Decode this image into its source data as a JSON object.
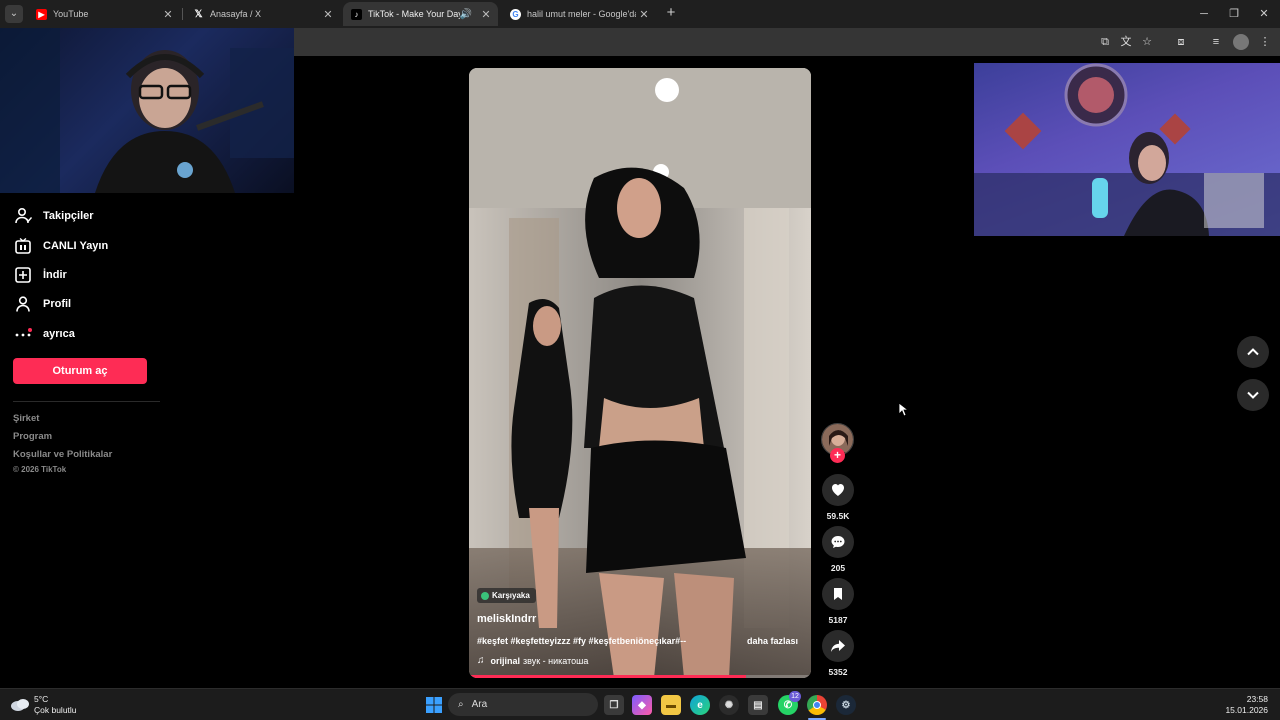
{
  "browser": {
    "tabs": [
      {
        "title": "YouTube",
        "active": false,
        "icon": "youtube-icon"
      },
      {
        "title": "Anasayfa / X",
        "active": false,
        "icon": "x-icon"
      },
      {
        "title": "TikTok - Make Your Day",
        "active": true,
        "icon": "tiktok-icon",
        "audio": true
      },
      {
        "title": "halil umut meler - Google'da Ara",
        "active": false,
        "icon": "google-icon"
      }
    ],
    "new_tab_icon": "plus-icon",
    "window_controls": [
      "minimize-icon",
      "restore-icon",
      "close-icon"
    ]
  },
  "sidebar": {
    "items": [
      {
        "label": "Takipçiler",
        "icon": "person-follow-icon"
      },
      {
        "label": "CANLI Yayın",
        "icon": "live-tv-icon"
      },
      {
        "label": "İndir",
        "icon": "download-box-icon"
      },
      {
        "label": "Profil",
        "icon": "profile-icon"
      },
      {
        "label": "ayrıca",
        "icon": "more-dots-icon"
      }
    ],
    "login_label": "Oturum aç",
    "footer_links": [
      "Şirket",
      "Program",
      "Koşullar ve Politikalar"
    ],
    "copyright": "© 2026 TikTok"
  },
  "video": {
    "location": "Karşıyaka",
    "username": "meliskIndrr",
    "caption": "#keşfet #keşfetteyizzz #fy #keşfetbeniöneçıkar#--",
    "more_label": "daha fazlası",
    "music_prefix": "orijinal",
    "music_title": "звук - никатоша",
    "progress": 0.81
  },
  "actions": {
    "likes": "59.5K",
    "comments": "205",
    "saves": "5187",
    "shares": "5352"
  },
  "taskbar": {
    "weather_temp": "5°C",
    "weather_desc": "Çok bulutlu",
    "search_placeholder": "Ara",
    "whatsapp_badge": "12",
    "time": "23:58",
    "date": "15.01.2026"
  },
  "colors": {
    "accent": "#fe2c55",
    "background": "#000000",
    "chrome": "#1f1f1f"
  }
}
